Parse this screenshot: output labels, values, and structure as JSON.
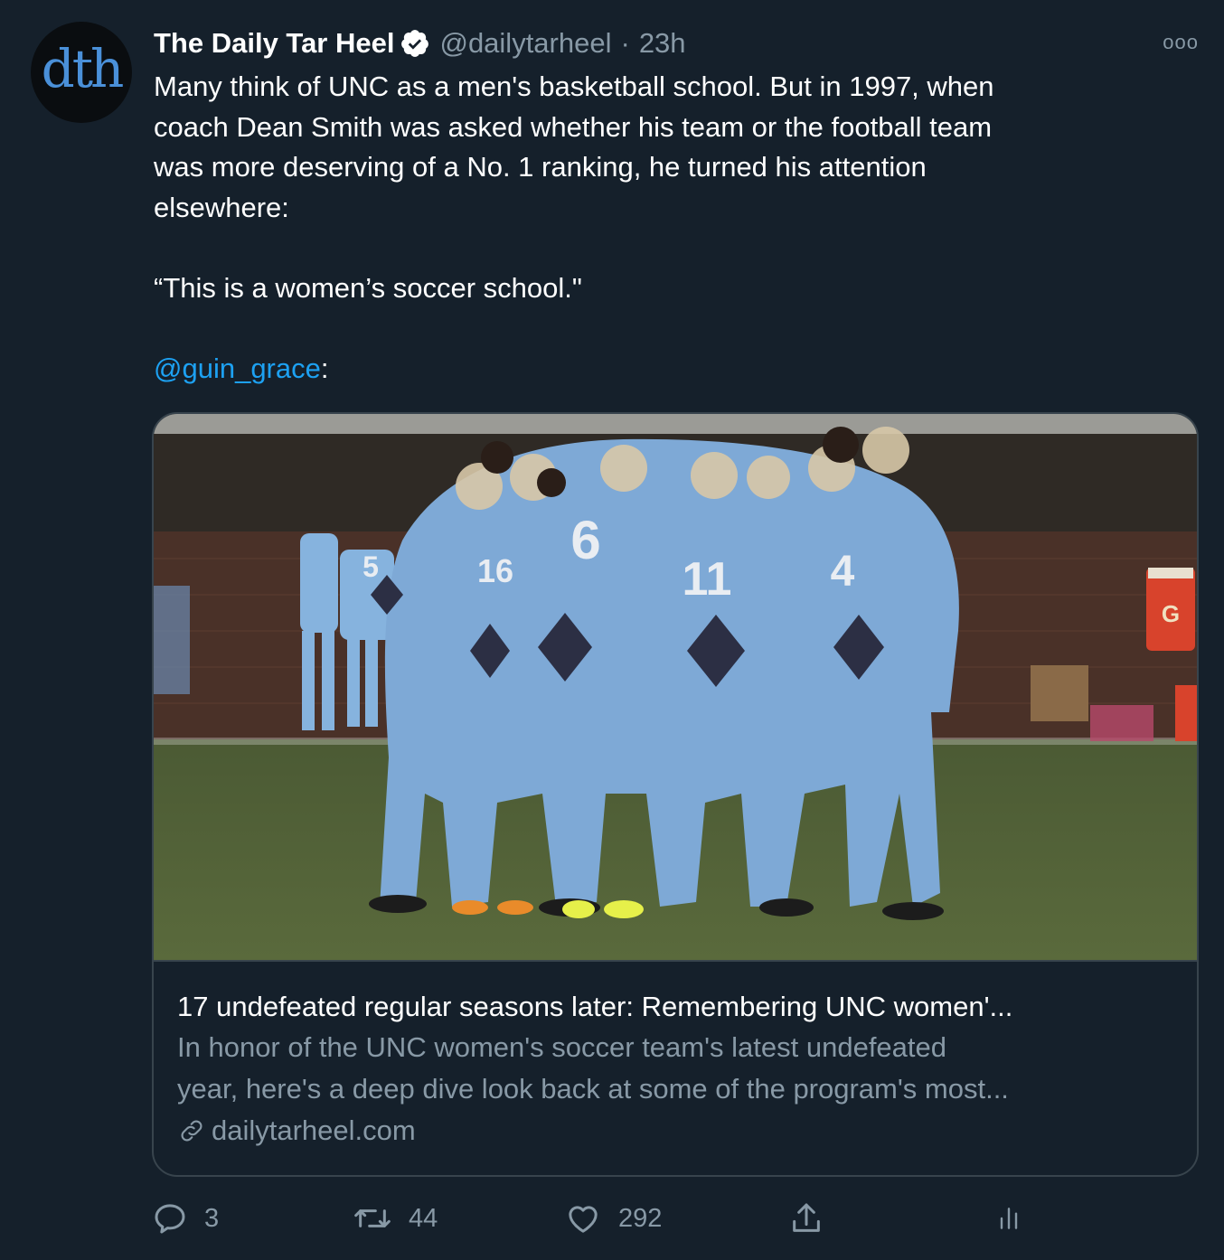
{
  "tweet": {
    "avatar_text": "dth",
    "display_name": "The Daily Tar Heel",
    "handle": "@dailytarheel",
    "separator": "·",
    "time": "23h",
    "more_label": "ooo",
    "text_lines": [
      "Many think of UNC as a men's basketball school. But in 1997, when",
      "coach Dean Smith was asked whether his team or the football team",
      "was more deserving of a No. 1 ranking, he turned his attention",
      "elsewhere:"
    ],
    "quote": "“This is a women’s soccer school.\"",
    "mention": "@guin_grace",
    "mention_suffix": ":"
  },
  "card": {
    "title": "17 undefeated regular seasons later: Remembering UNC women'...",
    "description_lines": [
      "In honor of the UNC women's soccer team's latest undefeated",
      "year, here's a deep dive look back at some of the program's most..."
    ],
    "domain": "dailytarheel.com",
    "image_jersey_numbers": [
      "5",
      "16",
      "6",
      "11",
      "4"
    ]
  },
  "actions": {
    "reply_count": "3",
    "retweet_count": "44",
    "like_count": "292"
  },
  "colors": {
    "background": "#15202b",
    "secondary_text": "#8899a6",
    "link": "#1da1f2",
    "border": "#38444d"
  }
}
